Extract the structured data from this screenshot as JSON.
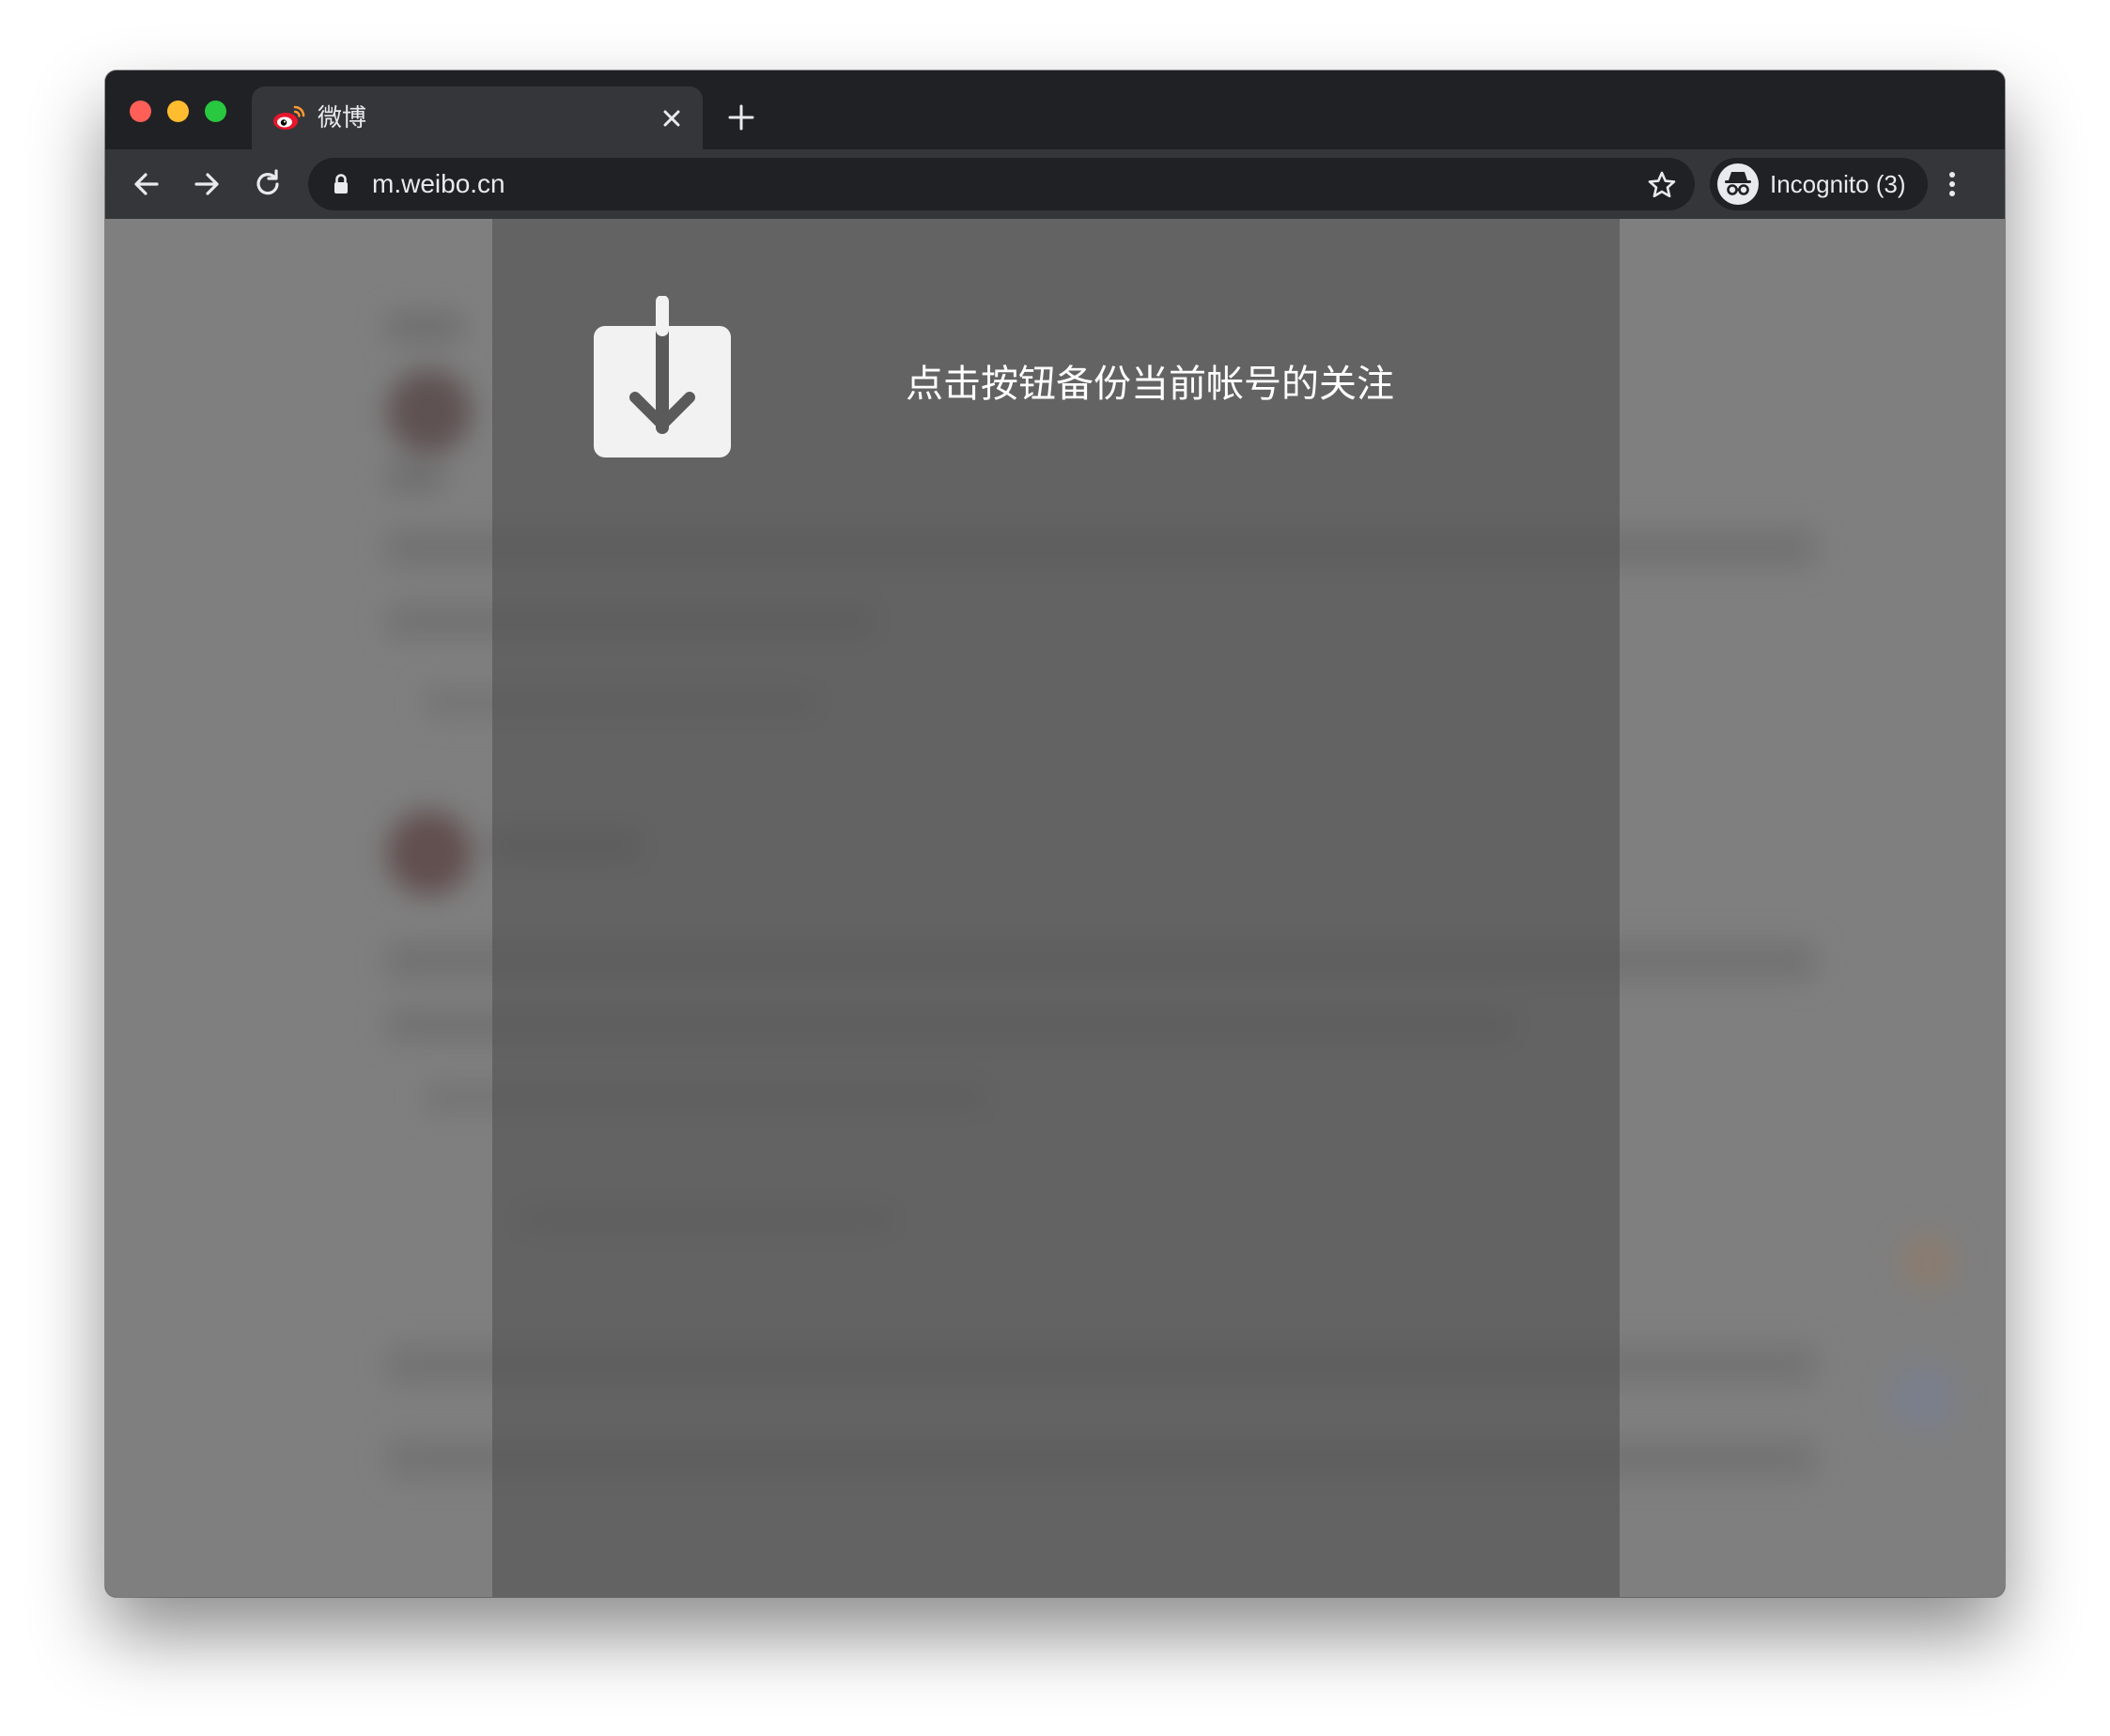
{
  "window": {
    "traffic_lights": {
      "close_color": "#ff5f57",
      "minimize_color": "#febc2e",
      "zoom_color": "#28c840"
    }
  },
  "tab": {
    "title": "微博",
    "favicon": "weibo-logo-icon",
    "close_icon": "close-icon",
    "new_tab_icon": "plus-icon"
  },
  "toolbar": {
    "back_icon": "arrow-left-icon",
    "forward_icon": "arrow-right-icon",
    "reload_icon": "reload-icon",
    "url": "m.weibo.cn",
    "secure_icon": "lock-icon",
    "bookmark_icon": "star-icon",
    "profile_label": "Incognito (3)",
    "profile_icon": "incognito-icon",
    "menu_icon": "more-vert-icon"
  },
  "page": {
    "backup_button_icon": "download-arrow-icon",
    "prompt": "点击按钮备份当前帐号的关注"
  },
  "colors": {
    "frame": "#202124",
    "toolbar": "#35363a",
    "overlay_page": "#7f7f7f",
    "panel": "#5e5e5e"
  }
}
